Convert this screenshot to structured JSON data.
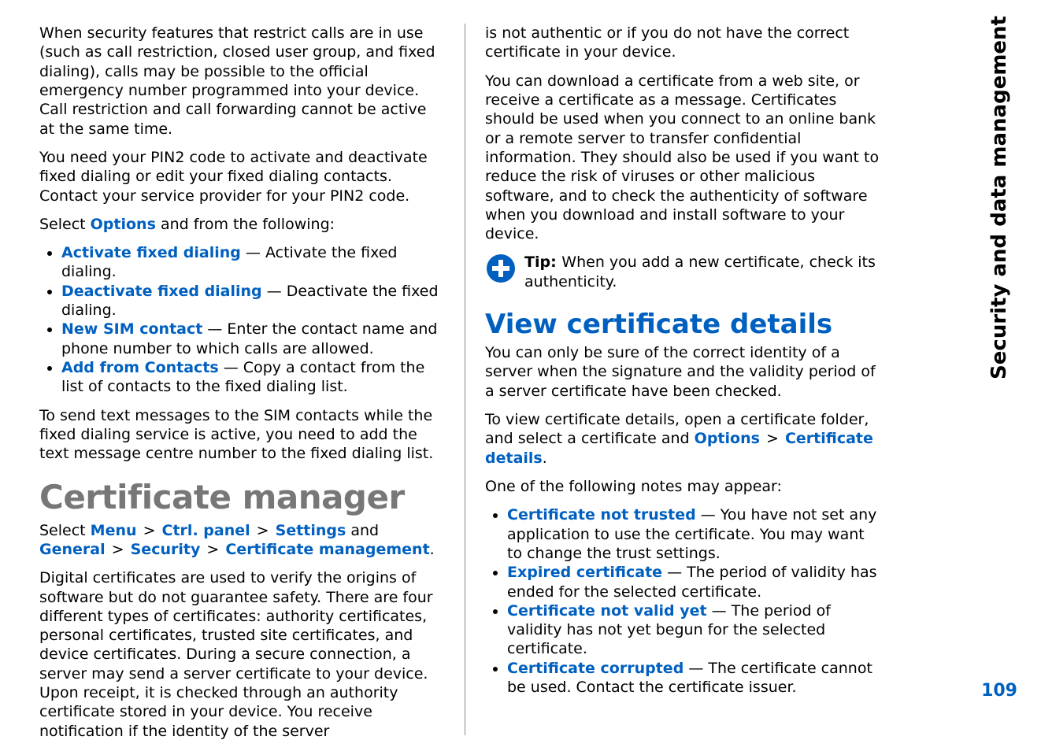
{
  "side": {
    "title": "Security and data management",
    "page_number": "109"
  },
  "col1": {
    "p1": "When security features that restrict calls are in use (such as call restriction, closed user group, and fixed dialing), calls may be possible to the official emergency number programmed into your device. Call restriction and call forwarding cannot be active at the same time.",
    "p2": "You need your PIN2 code to activate and deactivate fixed dialing or edit your fixed dialing contacts. Contact your service provider for your PIN2 code.",
    "p3_pre": "Select ",
    "p3_link": "Options",
    "p3_post": " and from the following:",
    "items": [
      {
        "label": "Activate fixed dialing",
        "desc": " — Activate the fixed dialing."
      },
      {
        "label": "Deactivate fixed dialing",
        "desc": " — Deactivate the fixed dialing."
      },
      {
        "label": "New SIM contact",
        "desc": " — Enter the contact name and phone number to which calls are allowed."
      },
      {
        "label": "Add from Contacts",
        "desc": " — Copy a contact from the list of contacts to the fixed dialing list."
      }
    ],
    "p4": "To send text messages to the SIM contacts while the fixed dialing service is active, you need to add the text message centre number to the fixed dialing list.",
    "h1": "Certificate manager",
    "nav_pre": "Select ",
    "nav1": "Menu",
    "nav2": "Ctrl. panel",
    "nav3": "Settings",
    "nav_and": " and ",
    "nav4": "General",
    "nav5": "Security",
    "nav6": "Certificate management",
    "nav_period": ".",
    "gt": ">",
    "p5": "Digital certificates are used to verify the origins of software but do not guarantee safety. There are four different types of certificates: authority certificates, personal certificates, trusted site certificates, and device certificates. During a secure connection, a server may send a server certificate to your device. Upon receipt, it is checked through an authority certificate stored in your device. You receive notification if the identity of the server"
  },
  "col2": {
    "p1": "is not authentic or if you do not have the correct certificate in your device.",
    "p2": "You can download a certificate from a web site, or receive a certificate as a message. Certificates should be used when you connect to an online bank or a remote server to transfer confidential information. They should also be used if you want to reduce the risk of viruses or other malicious software, and to check the authenticity of software when you download and install software to your device.",
    "tip_label": "Tip: ",
    "tip_text": "When you add a new certificate, check its authenticity.",
    "h2": "View certificate details",
    "p3": "You can only be sure of the correct identity of a server when the signature and the validity period of a server certificate have been checked.",
    "p4_pre": "To view certificate details, open a certificate folder, and select a certificate and ",
    "p4_l1": "Options",
    "p4_gt": ">",
    "p4_l2": "Certificate details",
    "p4_post": ".",
    "p5": "One of the following notes may appear:",
    "items": [
      {
        "label": "Certificate not trusted",
        "desc": " — You have not set any application to use the certificate. You may want to change the trust settings."
      },
      {
        "label": "Expired certificate",
        "desc": " — The period of validity has ended for the selected certificate."
      },
      {
        "label": "Certificate not valid yet",
        "desc": " — The period of validity has not yet begun for the selected certificate."
      },
      {
        "label": "Certificate corrupted",
        "desc": " — The certificate cannot be used. Contact the certificate issuer."
      }
    ]
  }
}
